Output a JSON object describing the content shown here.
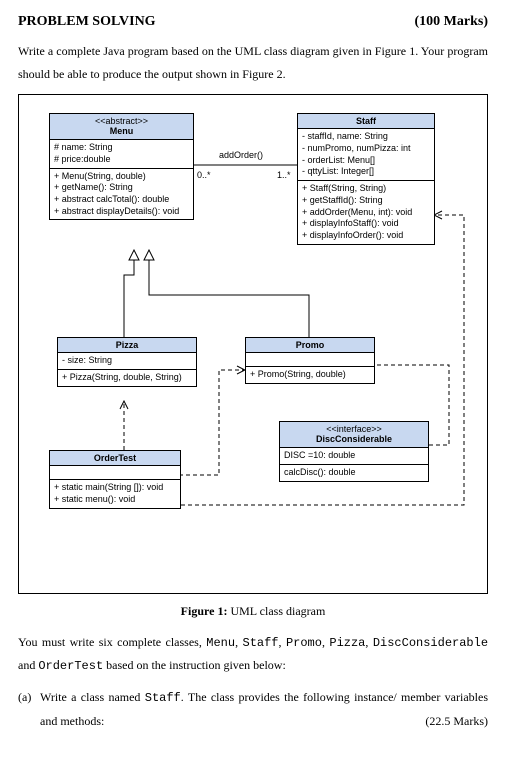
{
  "header": {
    "title": "PROBLEM SOLVING",
    "marks": "(100 Marks)"
  },
  "intro": "Write a complete Java program based on the UML class diagram given in Figure 1. Your program should be able to produce the output shown in Figure 2.",
  "caption_bold": "Figure 1:",
  "caption_rest": " UML class diagram",
  "outro_parts": {
    "p1": "You must write six complete classes, ",
    "c1": "Menu",
    "p2": ", ",
    "c2": "Staff",
    "p3": ", ",
    "c3": "Promo",
    "p4": ", ",
    "c4": "Pizza",
    "p5": ", ",
    "c5": "DiscConsiderable",
    "p6": " and ",
    "c6": "OrderTest",
    "p7": " based on the instruction given below:"
  },
  "item_a": {
    "label": "(a)",
    "text1": "Write a class named ",
    "code": "Staff",
    "text2": ". The class provides the following instance/ member variables and methods:",
    "marks": "(22.5 Marks)"
  },
  "uml": {
    "menu": {
      "stereo": "<<abstract>>",
      "name": "Menu",
      "attrs": [
        "# name: String",
        "# price:double"
      ],
      "ops": [
        "+ Menu(String, double)",
        "+ getName(): String",
        "+ abstract calcTotal(): double",
        "+ abstract displayDetails(): void"
      ]
    },
    "staff": {
      "name": "Staff",
      "attrs": [
        "- staffId, name: String",
        "- numPromo, numPizza: int",
        "- orderList: Menu[]",
        "- qttyList: Integer[]"
      ],
      "ops": [
        "+ Staff(String, String)",
        "+ getStaffId(): String",
        "+ addOrder(Menu, int): void",
        "+ displayInfoStaff(): void",
        "+ displayInfoOrder(): void"
      ]
    },
    "pizza": {
      "name": "Pizza",
      "attrs": [
        "- size: String"
      ],
      "ops": [
        "+ Pizza(String, double, String)"
      ]
    },
    "promo": {
      "name": "Promo",
      "ops": [
        "+ Promo(String, double)"
      ]
    },
    "disc": {
      "stereo": "<<interface>>",
      "name": "DiscConsiderable",
      "attrs": [
        "DISC =10: double"
      ],
      "ops": [
        "calcDisc(): double"
      ]
    },
    "ordertest": {
      "name": "OrderTest",
      "ops": [
        "+ static main(String []): void",
        "+ static menu(): void"
      ]
    },
    "assoc_label": "addOrder()",
    "mult_left": "0..*",
    "mult_right": "1..*"
  },
  "chart_data": {
    "type": "table",
    "description": "UML class diagram with 6 classifiers and relationships",
    "classes": [
      {
        "name": "Menu",
        "stereotype": "abstract",
        "attributes": [
          "# name: String",
          "# price:double"
        ],
        "operations": [
          "+ Menu(String, double)",
          "+ getName(): String",
          "+ abstract calcTotal(): double",
          "+ abstract displayDetails(): void"
        ]
      },
      {
        "name": "Staff",
        "attributes": [
          "- staffId, name: String",
          "- numPromo, numPizza: int",
          "- orderList: Menu[]",
          "- qttyList: Integer[]"
        ],
        "operations": [
          "+ Staff(String, String)",
          "+ getStaffId(): String",
          "+ addOrder(Menu, int): void",
          "+ displayInfoStaff(): void",
          "+ displayInfoOrder(): void"
        ]
      },
      {
        "name": "Pizza",
        "attributes": [
          "- size: String"
        ],
        "operations": [
          "+ Pizza(String, double, String)"
        ]
      },
      {
        "name": "Promo",
        "operations": [
          "+ Promo(String, double)"
        ]
      },
      {
        "name": "DiscConsiderable",
        "stereotype": "interface",
        "attributes": [
          "DISC =10: double"
        ],
        "operations": [
          "calcDisc(): double"
        ]
      },
      {
        "name": "OrderTest",
        "operations": [
          "+ static main(String []): void",
          "+ static menu(): void"
        ]
      }
    ],
    "relationships": [
      {
        "from": "Menu",
        "to": "Staff",
        "type": "association",
        "label": "addOrder()",
        "from_mult": "0..*",
        "to_mult": "1..*"
      },
      {
        "from": "Pizza",
        "to": "Menu",
        "type": "generalization"
      },
      {
        "from": "Promo",
        "to": "Menu",
        "type": "generalization"
      },
      {
        "from": "Promo",
        "to": "DiscConsiderable",
        "type": "realization"
      },
      {
        "from": "OrderTest",
        "to": "Pizza",
        "type": "dependency"
      },
      {
        "from": "OrderTest",
        "to": "Promo",
        "type": "dependency"
      },
      {
        "from": "OrderTest",
        "to": "Staff",
        "type": "dependency"
      }
    ]
  }
}
